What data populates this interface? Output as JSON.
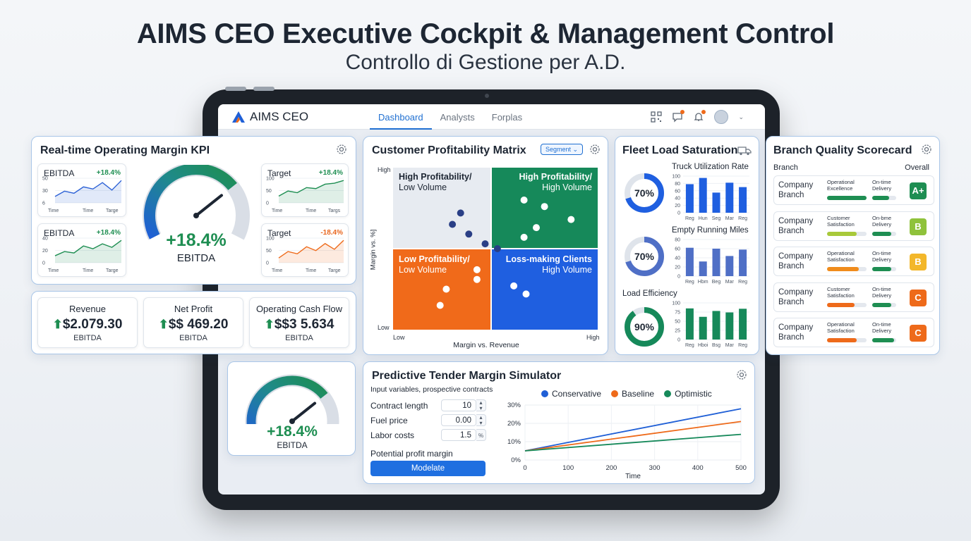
{
  "hero": {
    "title": "AIMS CEO Executive Cockpit & Management Control",
    "subtitle": "Controllo di Gestione per A.D."
  },
  "appbar": {
    "logo_text": "AIMS CEO",
    "nav": [
      "Dashboard",
      "Analysts",
      "Forplas"
    ],
    "active_nav": "Dashboard",
    "icons": [
      "qr-icon",
      "chat-icon",
      "bell-icon",
      "avatar",
      "chevron-down-icon"
    ]
  },
  "kpi": {
    "title": "Real-time Operating Margin KPI",
    "minis": [
      {
        "title": "EBITDA",
        "delta": "+18.4%",
        "trend": "up",
        "yticks": [
          "50",
          "30",
          "6"
        ],
        "xticks": [
          "Time",
          "Time",
          "Targe"
        ],
        "values": [
          12,
          22,
          18,
          30,
          26,
          38,
          24,
          42
        ]
      },
      {
        "title": "Target",
        "delta": "+18.4%",
        "trend": "up",
        "yticks": [
          "100",
          "50",
          "0"
        ],
        "xticks": [
          "Time",
          "Time",
          "Targs"
        ],
        "values": [
          20,
          35,
          30,
          45,
          42,
          55,
          58,
          66
        ]
      },
      {
        "title": "EBITDA",
        "delta": "+18.4%",
        "trend": "up",
        "yticks": [
          "40",
          "20",
          "0"
        ],
        "xticks": [
          "Time",
          "Time",
          "Targe"
        ],
        "values": [
          10,
          16,
          14,
          24,
          20,
          27,
          22,
          32
        ]
      },
      {
        "title": "Target",
        "delta": "-18.4%",
        "trend": "down",
        "yticks": [
          "100",
          "50",
          "0"
        ],
        "xticks": [
          "Time",
          "Time",
          "Targe"
        ],
        "values": [
          15,
          35,
          28,
          50,
          38,
          60,
          42,
          70
        ]
      }
    ],
    "gauge": {
      "value": "+18.4%",
      "label": "EBITDA",
      "level": 0.72
    }
  },
  "stats": [
    {
      "label": "Revenue",
      "value": "$2.079.30",
      "sub": "EBITDA"
    },
    {
      "label": "Net Profit",
      "value": "$$ 469.20",
      "sub": "EBITDA"
    },
    {
      "label": "Operating Cash Flow",
      "value": "$$3 5.634",
      "sub": "EBITDA"
    }
  ],
  "gauge2": {
    "value": "+18.4%",
    "label": "EBITDA",
    "level": 0.72
  },
  "matrix": {
    "title": "Customer Profitability Matrix",
    "segment_label": "Segment",
    "y_high": "High",
    "y_low": "Low",
    "x_low": "Low",
    "x_high": "High",
    "y_axis": "Margin vs. %]",
    "x_axis": "Margin vs. Revenue",
    "quadrants": [
      {
        "line1": "High Profitability/",
        "line2": "Low Volume"
      },
      {
        "line1": "High Profitability/",
        "line2": "High Volume"
      },
      {
        "line1": "Low Profitability/",
        "line2": "Low Volume"
      },
      {
        "line1": "Loss-making Clients",
        "line2": "High Volume"
      }
    ],
    "points": [
      {
        "x": 0.33,
        "y": 0.72,
        "q": "tl"
      },
      {
        "x": 0.29,
        "y": 0.65,
        "q": "tl"
      },
      {
        "x": 0.37,
        "y": 0.59,
        "q": "tl"
      },
      {
        "x": 0.45,
        "y": 0.53,
        "q": "tl"
      },
      {
        "x": 0.51,
        "y": 0.5,
        "q": "tl"
      },
      {
        "x": 0.64,
        "y": 0.8,
        "q": "tr"
      },
      {
        "x": 0.74,
        "y": 0.76,
        "q": "tr"
      },
      {
        "x": 0.87,
        "y": 0.68,
        "q": "tr"
      },
      {
        "x": 0.7,
        "y": 0.63,
        "q": "tr"
      },
      {
        "x": 0.64,
        "y": 0.57,
        "q": "tr"
      },
      {
        "x": 0.41,
        "y": 0.37,
        "q": "bl"
      },
      {
        "x": 0.41,
        "y": 0.31,
        "q": "bl"
      },
      {
        "x": 0.26,
        "y": 0.25,
        "q": "bl"
      },
      {
        "x": 0.23,
        "y": 0.15,
        "q": "bl"
      },
      {
        "x": 0.59,
        "y": 0.27,
        "q": "br"
      },
      {
        "x": 0.65,
        "y": 0.22,
        "q": "br"
      }
    ]
  },
  "fleet": {
    "title": "Fleet Load Saturation",
    "sections": [
      {
        "title": "Truck Utilization Rate",
        "pct": "70%",
        "level": 0.7,
        "ring_color": "#1f5fe0",
        "bar_color": "#1f5fe0",
        "yticks": [
          "100",
          "80",
          "60",
          "40",
          "20",
          "0"
        ],
        "xlabels": [
          "Reg",
          "Hun",
          "Seg",
          "Mar",
          "Reg"
        ],
        "bars": [
          78,
          95,
          55,
          82,
          70
        ]
      },
      {
        "title": "Empty Running Miles",
        "pct": "70%",
        "level": 0.7,
        "ring_color": "#4f6fc6",
        "bar_color": "#4f6fc6",
        "yticks": [
          "80",
          "60",
          "40",
          "20",
          "0"
        ],
        "xlabels": [
          "Reg",
          "Hbm",
          "Beg",
          "Mar",
          "Reg"
        ],
        "bars": [
          62,
          32,
          60,
          44,
          58
        ]
      },
      {
        "title": "Load Efficiency",
        "pct": "90%",
        "level": 0.9,
        "ring_color": "#16895a",
        "bar_color": "#16895a",
        "yticks": [
          "100",
          "75",
          "50",
          "25",
          "0"
        ],
        "xlabels": [
          "Reg",
          "Hboi",
          "Bsg",
          "Mar",
          "Reg"
        ],
        "bars": [
          85,
          62,
          78,
          74,
          84
        ]
      }
    ]
  },
  "branch": {
    "title": "Branch Quality Scorecard",
    "col_branch": "Branch",
    "col_overall": "Overall",
    "rows": [
      {
        "name": "Company Branch",
        "metric1": "Operational Excellence",
        "metric2": "On-time Delivery",
        "v1": 1.0,
        "v2": 0.7,
        "c1": "#1e8e52",
        "c2": "#1e8e52",
        "grade": "A+",
        "grade_color": "#1e8e52"
      },
      {
        "name": "Company Branch",
        "metric1": "Customer Satisfaction",
        "metric2": "On-bme Delivery",
        "v1": 0.75,
        "v2": 0.8,
        "c1": "#a8c93a",
        "c2": "#1e8e52",
        "grade": "B",
        "grade_color": "#8fc23b"
      },
      {
        "name": "Company Branch",
        "metric1": "Operational Satisfaction",
        "metric2": "On-time Delivery",
        "v1": 0.8,
        "v2": 0.8,
        "c1": "#f08c1c",
        "c2": "#1e8e52",
        "grade": "B",
        "grade_color": "#f3b72a"
      },
      {
        "name": "Company Branch",
        "metric1": "Customer Satisfaction",
        "metric2": "On-time Delivery",
        "v1": 0.7,
        "v2": 0.8,
        "c1": "#ee6a1a",
        "c2": "#1e8e52",
        "grade": "C",
        "grade_color": "#ee6a1a"
      },
      {
        "name": "Company Branch",
        "metric1": "Operational Satisfaction",
        "metric2": "On-time Delivery",
        "v1": 0.75,
        "v2": 0.9,
        "c1": "#ee6a1a",
        "c2": "#1e8e52",
        "grade": "C",
        "grade_color": "#ee6a1a"
      }
    ]
  },
  "simulator": {
    "title": "Predictive Tender Margin Simulator",
    "subtitle": "Input variables, prospective contracts",
    "inputs": [
      {
        "label": "Contract length",
        "value": "10",
        "spin": "up-down"
      },
      {
        "label": "Fuel price",
        "value": "0.00",
        "spin": "up-down"
      },
      {
        "label": "Labor costs",
        "value": "1.5",
        "spin": "%"
      }
    ],
    "output_label": "Potential profit margin",
    "button": "Modelate"
  },
  "chart_data": {
    "type": "line",
    "x": [
      0,
      500
    ],
    "xticks": [
      "0",
      "100",
      "200",
      "300",
      "400",
      "500"
    ],
    "yticks": [
      "30%",
      "20%",
      "10%",
      "0%"
    ],
    "xlabel": "Time",
    "ylim": [
      0,
      30
    ],
    "xlim": [
      0,
      500
    ],
    "series": [
      {
        "name": "Conservative",
        "color": "#1f5fd6",
        "values": [
          5,
          28
        ]
      },
      {
        "name": "Baseline",
        "color": "#ee6a1a",
        "values": [
          5,
          21
        ]
      },
      {
        "name": "Optimistic",
        "color": "#16895a",
        "values": [
          5,
          14
        ]
      }
    ],
    "legend": "top"
  }
}
